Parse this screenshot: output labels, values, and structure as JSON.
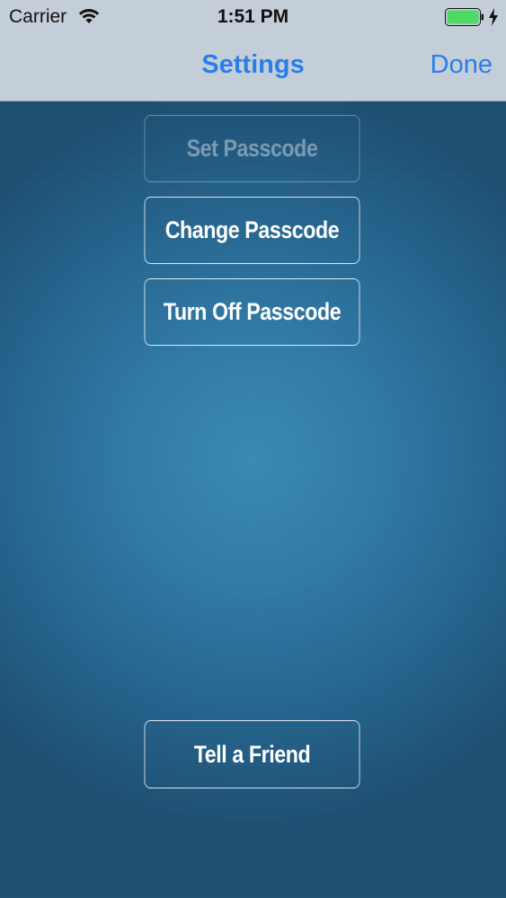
{
  "status_bar": {
    "carrier": "Carrier",
    "time": "1:51 PM",
    "battery_color": "#4cd964"
  },
  "nav": {
    "title": "Settings",
    "done_label": "Done",
    "tint_color": "#2a7ee8"
  },
  "buttons": {
    "set_passcode": "Set Passcode",
    "change_passcode": "Change Passcode",
    "turn_off_passcode": "Turn Off Passcode",
    "tell_a_friend": "Tell a Friend"
  }
}
